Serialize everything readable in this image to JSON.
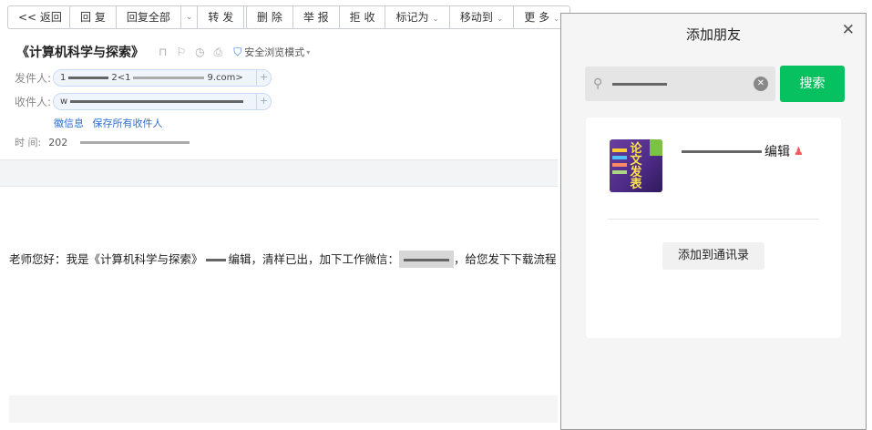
{
  "toolbar": {
    "back": "<< 返回",
    "reply": "回 复",
    "reply_all": "回复全部",
    "forward": "转 发",
    "delete": "删 除",
    "report": "举 报",
    "reject": "拒 收",
    "mark_as": "标记为",
    "move_to": "移动到",
    "more": "更 多",
    "dropdown_glyph": "⌄"
  },
  "mail": {
    "subject": "《计算机科学与探索》",
    "safe_mode": "安全浏览模式",
    "from_label": "发件人:",
    "from_prefix": "1",
    "from_mid": "2<1",
    "from_suffix": "9.com>",
    "to_label": "收件人:",
    "to_prefix": "w",
    "link_contact": "徽信息",
    "link_save": "保存所有收件人",
    "time_label": "时  间:",
    "time_prefix": "202",
    "body_text_1": "老师您好：我是《计算机科学与探索》",
    "body_text_2": "编辑，清样已出，加下工作微信：",
    "body_text_3": "，给您发下下载流程"
  },
  "dialog": {
    "title": "添加朋友",
    "search_value": "",
    "search_button": "搜索",
    "result_name_suffix": "编辑",
    "avatar_text": "论文发表",
    "add_button": "添加到通讯录"
  },
  "icons": {
    "search": "search-icon",
    "close": "close-icon",
    "clear": "clear-icon",
    "gender": "person-icon",
    "shield": "shield-icon"
  },
  "colors": {
    "accent_green": "#07c160",
    "link_blue": "#2f6fd1"
  }
}
